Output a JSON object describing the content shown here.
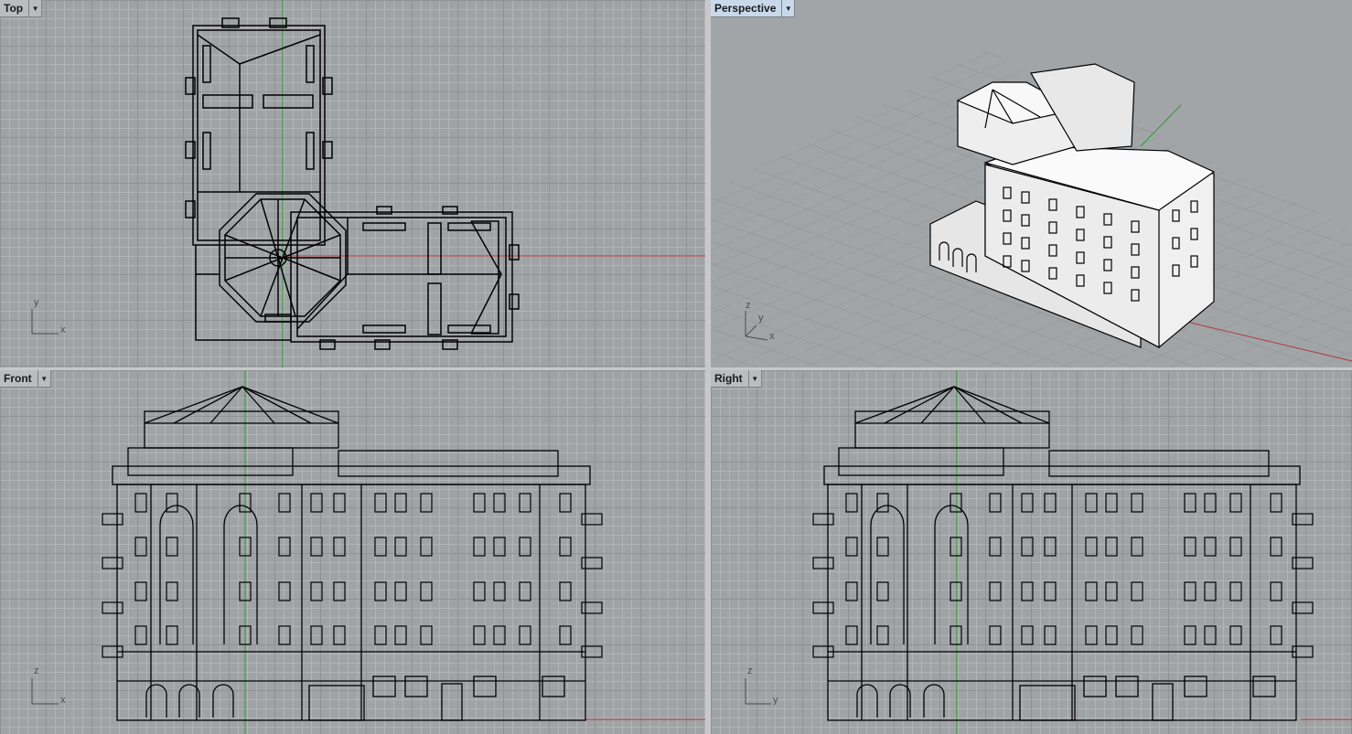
{
  "viewports": {
    "top": {
      "title": "Top",
      "axes": [
        "y",
        "x"
      ]
    },
    "perspective": {
      "title": "Perspective",
      "axes": [
        "z",
        "y",
        "x"
      ]
    },
    "front": {
      "title": "Front",
      "axes": [
        "z",
        "x"
      ]
    },
    "right": {
      "title": "Right",
      "axes": [
        "z",
        "y"
      ]
    }
  },
  "icons": {
    "menu": "dropdown-arrow-icon"
  },
  "colors": {
    "viewport_bg": "#9fa3a6",
    "grid_major": "#8f9396",
    "grid_minor": "#b2b5b8",
    "x_axis": "#b33a3a",
    "y_axis": "#2e9e2e",
    "model_lines": "#000000",
    "active_title_bg": "#c8d9ec"
  }
}
